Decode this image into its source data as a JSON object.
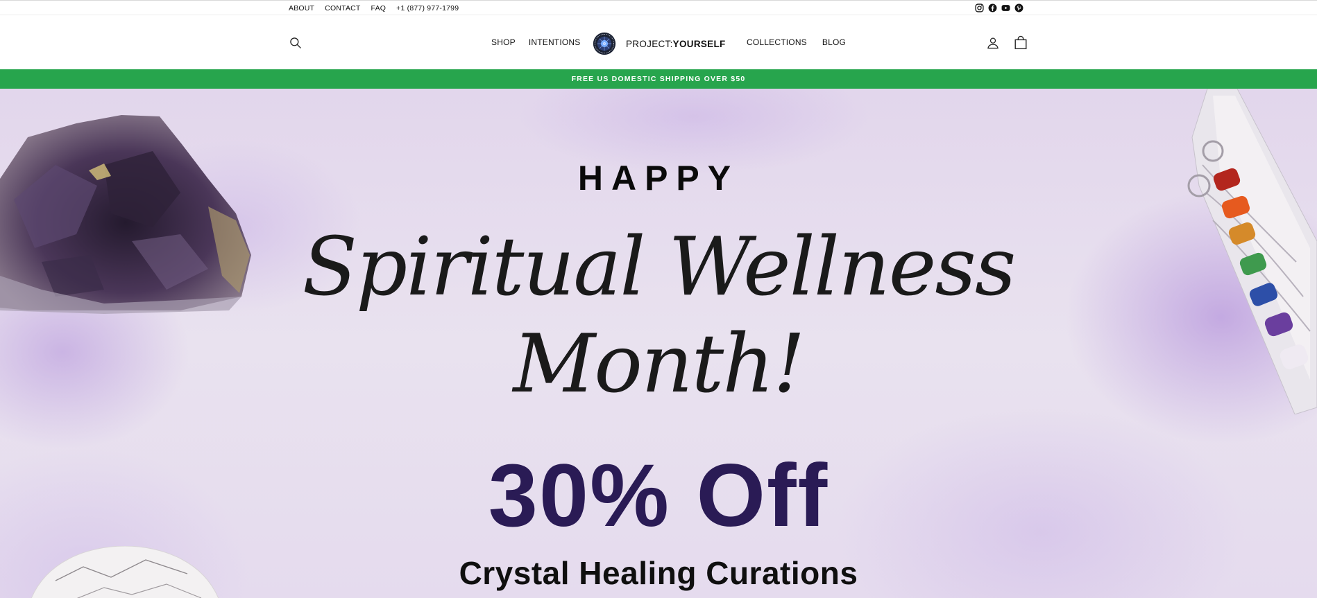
{
  "utility": {
    "links": [
      "ABOUT",
      "CONTACT",
      "FAQ",
      "+1 (877) 977-1799"
    ],
    "social_icons": [
      "instagram-icon",
      "facebook-icon",
      "youtube-icon",
      "pinterest-icon"
    ]
  },
  "nav": {
    "left": [
      "SHOP",
      "INTENTIONS"
    ],
    "right": [
      "COLLECTIONS",
      "BLOG"
    ],
    "logo_prefix": "PROJECT:",
    "logo_suffix": "YOURSELF",
    "icons": [
      "search-icon",
      "account-icon",
      "cart-icon"
    ]
  },
  "promo": {
    "text": "FREE US DOMESTIC SHIPPING OVER $50",
    "color": "#27a54d"
  },
  "hero": {
    "kicker": "HAPPY",
    "headline_line1": "Spiritual Wellness",
    "headline_line2": "Month!",
    "discount": "30% Off",
    "subheadline": "Crystal Healing Curations",
    "discount_color": "#2a1b55"
  }
}
